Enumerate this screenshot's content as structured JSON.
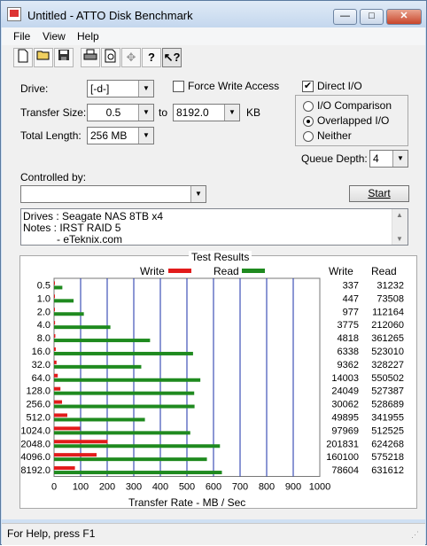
{
  "window": {
    "title": "Untitled - ATTO Disk Benchmark",
    "min_glyph": "—",
    "max_glyph": "□",
    "close_glyph": "✕"
  },
  "menu": {
    "file": "File",
    "view": "View",
    "help": "Help"
  },
  "toolbar": {
    "icons": [
      "new-file-icon",
      "open-folder-icon",
      "save-icon",
      "print-icon",
      "print-preview-icon",
      "move-icon",
      "help-icon",
      "context-help-icon"
    ]
  },
  "form": {
    "drive_label": "Drive:",
    "drive_value": "[-d-]",
    "force_write_label": "Force Write Access",
    "direct_io_label": "Direct I/O",
    "transfer_size_label": "Transfer Size:",
    "transfer_from": "0.5",
    "to_label": "to",
    "transfer_to": "8192.0",
    "kb_label": "KB",
    "total_length_label": "Total Length:",
    "total_length_value": "256 MB",
    "io_comparison_label": "I/O Comparison",
    "overlapped_io_label": "Overlapped I/O",
    "neither_label": "Neither",
    "queue_depth_label": "Queue Depth:",
    "queue_depth_value": "4",
    "controlled_by_label": "Controlled by:",
    "controlled_by_value": "",
    "start_label": "Start",
    "force_write_checked": false,
    "direct_io_checked": true,
    "io_mode_selected": "Overlapped I/O"
  },
  "notes": {
    "line1": "Drives : Seagate NAS 8TB x4",
    "line2": "Notes : IRST RAID 5",
    "line3": "- eTeknix.com"
  },
  "results": {
    "title": "Test Results",
    "write_legend": "Write",
    "read_legend": "Read",
    "write_header": "Write",
    "read_header": "Read",
    "write_color": "#e21b1b",
    "read_color": "#1f8a1f",
    "rows": [
      {
        "size": "0.5",
        "write": "337",
        "read": "31232"
      },
      {
        "size": "1.0",
        "write": "447",
        "read": "73508"
      },
      {
        "size": "2.0",
        "write": "977",
        "read": "112164"
      },
      {
        "size": "4.0",
        "write": "3775",
        "read": "212060"
      },
      {
        "size": "8.0",
        "write": "4818",
        "read": "361265"
      },
      {
        "size": "16.0",
        "write": "6338",
        "read": "523010"
      },
      {
        "size": "32.0",
        "write": "9362",
        "read": "328227"
      },
      {
        "size": "64.0",
        "write": "14003",
        "read": "550502"
      },
      {
        "size": "128.0",
        "write": "24049",
        "read": "527387"
      },
      {
        "size": "256.0",
        "write": "30062",
        "read": "528689"
      },
      {
        "size": "512.0",
        "write": "49895",
        "read": "341955"
      },
      {
        "size": "1024.0",
        "write": "97969",
        "read": "512525"
      },
      {
        "size": "2048.0",
        "write": "201831",
        "read": "624268"
      },
      {
        "size": "4096.0",
        "write": "160100",
        "read": "575218"
      },
      {
        "size": "8192.0",
        "write": "78604",
        "read": "631612"
      }
    ]
  },
  "chart_data": {
    "type": "bar",
    "orientation": "horizontal",
    "categories": [
      "0.5",
      "1.0",
      "2.0",
      "4.0",
      "8.0",
      "16.0",
      "32.0",
      "64.0",
      "128.0",
      "256.0",
      "512.0",
      "1024.0",
      "2048.0",
      "4096.0",
      "8192.0"
    ],
    "series": [
      {
        "name": "Write",
        "values": [
          337,
          447,
          977,
          3775,
          4818,
          6338,
          9362,
          14003,
          24049,
          30062,
          49895,
          97969,
          201831,
          160100,
          78604
        ]
      },
      {
        "name": "Read",
        "values": [
          31232,
          73508,
          112164,
          212060,
          361265,
          523010,
          328227,
          550502,
          527387,
          528689,
          341955,
          512525,
          624268,
          575218,
          631612
        ]
      }
    ],
    "xlabel": "Transfer Rate - MB / Sec",
    "xticks": [
      "0",
      "100",
      "200",
      "300",
      "400",
      "500",
      "600",
      "700",
      "800",
      "900",
      "1000"
    ],
    "xlim": [
      0,
      1000
    ],
    "grid": "vertical"
  },
  "status": {
    "text": "For Help, press F1"
  }
}
